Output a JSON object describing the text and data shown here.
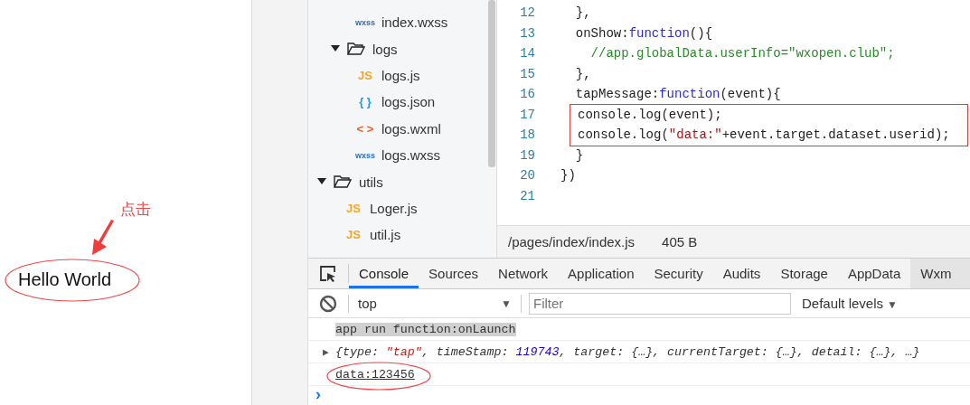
{
  "simulator": {
    "annotation": "点击",
    "button_text": "Hello World"
  },
  "file_tree": [
    {
      "kind": "group",
      "children": [
        {
          "kind": "group",
          "children": [
            {
              "kind": "file",
              "icon": "wxss",
              "color": "#2a6fc9",
              "label": "index.wxss"
            }
          ]
        },
        {
          "kind": "folder",
          "label": "logs",
          "expanded": true,
          "children": [
            {
              "kind": "file",
              "icon": "JS",
              "color": "#f5a623",
              "label": "logs.js"
            },
            {
              "kind": "file",
              "icon": "{ }",
              "color": "#1e9de0",
              "label": "logs.json"
            },
            {
              "kind": "file",
              "icon": "< >",
              "color": "#f05a24",
              "label": "logs.wxml"
            },
            {
              "kind": "file",
              "icon": "wxss",
              "color": "#2a6fc9",
              "label": "logs.wxss"
            }
          ]
        }
      ]
    },
    {
      "kind": "folder",
      "label": "utils",
      "expanded": true,
      "children": [
        {
          "kind": "file",
          "icon": "JS",
          "color": "#f5a623",
          "label": "Loger.js"
        },
        {
          "kind": "file",
          "icon": "JS",
          "color": "#f5a623",
          "label": "util.js"
        }
      ]
    }
  ],
  "editor": {
    "lines": [
      {
        "number": "12",
        "boxed": false,
        "tokens": [
          {
            "kind": "plain",
            "text": "  },"
          }
        ]
      },
      {
        "number": "13",
        "boxed": false,
        "tokens": [
          {
            "kind": "plain",
            "text": "  onShow:"
          },
          {
            "kind": "keyword",
            "text": "function"
          },
          {
            "kind": "plain",
            "text": "(){"
          }
        ]
      },
      {
        "number": "14",
        "boxed": false,
        "tokens": [
          {
            "kind": "comment",
            "text": "    //app.globalData.userInfo=\"wxopen.club\";"
          }
        ]
      },
      {
        "number": "15",
        "boxed": false,
        "tokens": [
          {
            "kind": "plain",
            "text": "  },"
          }
        ]
      },
      {
        "number": "16",
        "boxed": false,
        "tokens": [
          {
            "kind": "plain",
            "text": "  tapMessage:"
          },
          {
            "kind": "keyword",
            "text": "function"
          },
          {
            "kind": "plain",
            "text": "(event){"
          }
        ]
      },
      {
        "number": "17",
        "boxed": true,
        "tokens": [
          {
            "kind": "plain",
            "text": "console.log(event);"
          }
        ]
      },
      {
        "number": "18",
        "boxed": true,
        "tokens": [
          {
            "kind": "plain",
            "text": "console.log("
          },
          {
            "kind": "string",
            "text": "\"data:\""
          },
          {
            "kind": "plain",
            "text": "+event.target.dataset.userid);"
          }
        ]
      },
      {
        "number": "19",
        "boxed": false,
        "tokens": [
          {
            "kind": "plain",
            "text": "  }"
          }
        ]
      },
      {
        "number": "20",
        "boxed": false,
        "tokens": [
          {
            "kind": "plain",
            "text": "})"
          }
        ]
      },
      {
        "number": "21",
        "boxed": false
      }
    ],
    "path": "/pages/index/index.js",
    "size": "405 B"
  },
  "devtools": {
    "tabs": [
      {
        "label": "Console",
        "selected": true
      },
      {
        "label": "Sources",
        "selected": false
      },
      {
        "label": "Network",
        "selected": false
      },
      {
        "label": "Application",
        "selected": false
      },
      {
        "label": "Security",
        "selected": false
      },
      {
        "label": "Audits",
        "selected": false
      },
      {
        "label": "Storage",
        "selected": false
      },
      {
        "label": "AppData",
        "selected": false
      },
      {
        "label": "Wxm",
        "selected": false
      }
    ],
    "context": "top",
    "context_caret": "▼",
    "filter_placeholder": "Filter",
    "levels": "Default levels",
    "levels_caret": "▼",
    "messages": [
      {
        "kind": "highlighted",
        "tokens": [
          {
            "kind": "plain",
            "text": "app run function:onLaunch"
          }
        ]
      },
      {
        "kind": "object",
        "toggle": "▶",
        "tokens": [
          {
            "kind": "plain",
            "text": "{type: "
          },
          {
            "kind": "string",
            "text": "\"tap\""
          },
          {
            "kind": "plain",
            "text": ", timeStamp: "
          },
          {
            "kind": "number",
            "text": "119743"
          },
          {
            "kind": "plain",
            "text": ", target: {…}, currentTarget: {…}, detail: {…}, …}"
          }
        ]
      },
      {
        "kind": "circled",
        "tokens": [
          {
            "kind": "plain",
            "text": "data:123456"
          }
        ]
      }
    ],
    "prompt": "›"
  }
}
